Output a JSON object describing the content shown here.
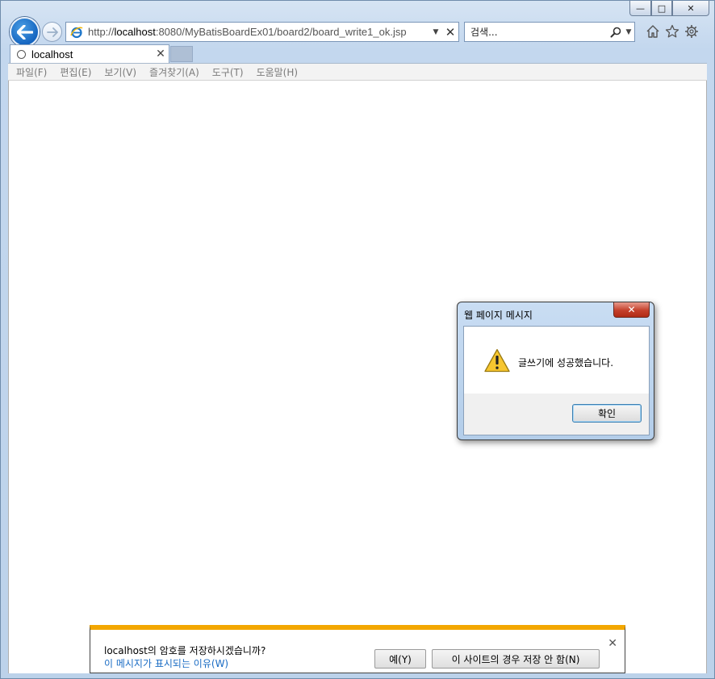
{
  "caption": {
    "minimize": "—",
    "maximize": "□",
    "close": "✕"
  },
  "address": {
    "url_prefix": "http://",
    "url_host": "localhost",
    "url_rest": ":8080/MyBatisBoardEx01/board2/board_write1_ok.jsp"
  },
  "search": {
    "placeholder": "검색..."
  },
  "tab": {
    "title": "localhost",
    "close": "✕"
  },
  "menu": [
    "파일(F)",
    "편집(E)",
    "보기(V)",
    "즐겨찾기(A)",
    "도구(T)",
    "도움말(H)"
  ],
  "dialog": {
    "title": "웹 페이지 메시지",
    "close": "✕",
    "message": "글쓰기에 성공했습니다.",
    "ok_label": "확인"
  },
  "notification": {
    "question": "localhost의 암호를 저장하시겠습니까?",
    "link": "이 메시지가 표시되는 이유(W)",
    "yes_label": "예(Y)",
    "never_label": "이 사이트의 경우 저장 안 함(N)",
    "close": "✕"
  },
  "colors": {
    "accent": "#1565c0",
    "notify_border": "#f3a700",
    "link": "#1a6cc4"
  }
}
